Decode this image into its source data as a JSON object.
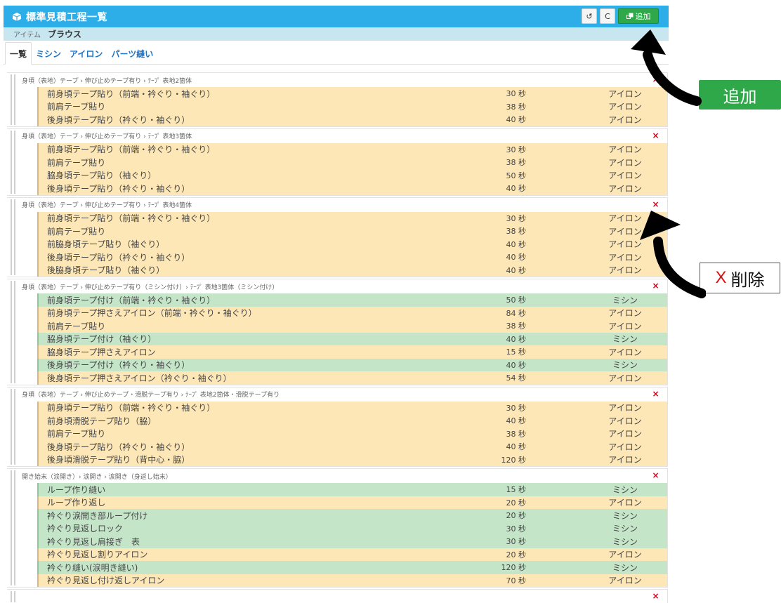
{
  "app": {
    "title": "標準見積工程一覧",
    "logo_icon": "cube-icon",
    "buttons": {
      "undo": "↺",
      "refresh": "C",
      "add": "追加"
    }
  },
  "item": {
    "label": "アイテム",
    "value": "ブラウス"
  },
  "tabs": [
    "一覧",
    "ミシン",
    "アイロン",
    "パーツ縫い"
  ],
  "groups": [
    {
      "path": "身頃（表地）テープ › 伸び止めテープ有り › ﾃｰﾌﾟ 表地2箇体",
      "rows": [
        {
          "name": "前身頃テープ貼り（前端・衿ぐり・袖ぐり）",
          "time": "30 秒",
          "proc": "アイロン",
          "type": "iron"
        },
        {
          "name": "前肩テープ貼り",
          "time": "38 秒",
          "proc": "アイロン",
          "type": "iron"
        },
        {
          "name": "後身頃テープ貼り（衿ぐり・袖ぐり）",
          "time": "40 秒",
          "proc": "アイロン",
          "type": "iron"
        }
      ]
    },
    {
      "path": "身頃（表地）テープ › 伸び止めテープ有り › ﾃｰﾌﾟ 表地3箇体",
      "rows": [
        {
          "name": "前身頃テープ貼り（前端・衿ぐり・袖ぐり）",
          "time": "30 秒",
          "proc": "アイロン",
          "type": "iron"
        },
        {
          "name": "前肩テープ貼り",
          "time": "38 秒",
          "proc": "アイロン",
          "type": "iron"
        },
        {
          "name": "脇身頃テープ貼り（袖ぐり）",
          "time": "50 秒",
          "proc": "アイロン",
          "type": "iron"
        },
        {
          "name": "後身頃テープ貼り（衿ぐり・袖ぐり）",
          "time": "40 秒",
          "proc": "アイロン",
          "type": "iron"
        }
      ]
    },
    {
      "path": "身頃（表地）テープ › 伸び止めテープ有り › ﾃｰﾌﾟ 表地4箇体",
      "rows": [
        {
          "name": "前身頃テープ貼り（前端・衿ぐり・袖ぐり）",
          "time": "30 秒",
          "proc": "アイロン",
          "type": "iron"
        },
        {
          "name": "前肩テープ貼り",
          "time": "38 秒",
          "proc": "アイロン",
          "type": "iron"
        },
        {
          "name": "前脇身頃テープ貼り（袖ぐり）",
          "time": "40 秒",
          "proc": "アイロン",
          "type": "iron"
        },
        {
          "name": "後身頃テープ貼り（衿ぐり・袖ぐり）",
          "time": "40 秒",
          "proc": "アイロン",
          "type": "iron"
        },
        {
          "name": "後脇身頃テープ貼り（袖ぐり）",
          "time": "40 秒",
          "proc": "アイロン",
          "type": "iron"
        }
      ]
    },
    {
      "path": "身頃（表地）テープ › 伸び止めテープ有り（ミシン付け）› ﾃｰﾌﾟ 表地3箇体（ミシン付け）",
      "rows": [
        {
          "name": "前身頃テープ付け（前端・衿ぐり・袖ぐり）",
          "time": "50 秒",
          "proc": "ミシン",
          "type": "mishin"
        },
        {
          "name": "前身頃テープ押さえアイロン（前端・衿ぐり・袖ぐり）",
          "time": "84 秒",
          "proc": "アイロン",
          "type": "iron"
        },
        {
          "name": "前肩テープ貼り",
          "time": "38 秒",
          "proc": "アイロン",
          "type": "iron"
        },
        {
          "name": "脇身頃テープ付け（袖ぐり）",
          "time": "40 秒",
          "proc": "ミシン",
          "type": "mishin"
        },
        {
          "name": "脇身頃テープ押さえアイロン",
          "time": "15 秒",
          "proc": "アイロン",
          "type": "iron"
        },
        {
          "name": "後身頃テープ付け（衿ぐり・袖ぐり）",
          "time": "40 秒",
          "proc": "ミシン",
          "type": "mishin"
        },
        {
          "name": "後身頃テープ押さえアイロン（衿ぐり・袖ぐり）",
          "time": "54 秒",
          "proc": "アイロン",
          "type": "iron"
        }
      ]
    },
    {
      "path": "身頃（表地）テープ › 伸び止めテープ・滑脱テープ有り › ﾃｰﾌﾟ 表地2箇体・滑脱テープ有り",
      "rows": [
        {
          "name": "前身頃テープ貼り（前端・衿ぐり・袖ぐり）",
          "time": "30 秒",
          "proc": "アイロン",
          "type": "iron"
        },
        {
          "name": "前身頃滑脱テープ貼り（脇）",
          "time": "40 秒",
          "proc": "アイロン",
          "type": "iron"
        },
        {
          "name": "前肩テープ貼り",
          "time": "38 秒",
          "proc": "アイロン",
          "type": "iron"
        },
        {
          "name": "後身頃テープ貼り（衿ぐり・袖ぐり）",
          "time": "40 秒",
          "proc": "アイロン",
          "type": "iron"
        },
        {
          "name": "後身頃滑脱テープ貼り（背中心・脇）",
          "time": "120 秒",
          "proc": "アイロン",
          "type": "iron"
        }
      ]
    },
    {
      "path": "開き始末（涙開き）› 涙開き › 涙開き（身返し始末）",
      "rows": [
        {
          "name": "ループ作り縫い",
          "time": "15 秒",
          "proc": "ミシン",
          "type": "mishin"
        },
        {
          "name": "ループ作り返し",
          "time": "20 秒",
          "proc": "アイロン",
          "type": "iron"
        },
        {
          "name": "衿ぐり涙開き部ループ付け",
          "time": "20 秒",
          "proc": "ミシン",
          "type": "mishin"
        },
        {
          "name": "衿ぐり見返しロック",
          "time": "30 秒",
          "proc": "ミシン",
          "type": "mishin"
        },
        {
          "name": "衿ぐり見返し肩接ぎ　表",
          "time": "30 秒",
          "proc": "ミシン",
          "type": "mishin"
        },
        {
          "name": "衿ぐり見返し割りアイロン",
          "time": "20 秒",
          "proc": "アイロン",
          "type": "iron"
        },
        {
          "name": "衿ぐり縫い(涙明き縫い)",
          "time": "120 秒",
          "proc": "ミシン",
          "type": "mishin"
        },
        {
          "name": "衿ぐり見返し付け返しアイロン",
          "time": "70 秒",
          "proc": "アイロン",
          "type": "iron"
        }
      ]
    },
    {
      "path": "",
      "rows": []
    }
  ],
  "delete_icon": "×",
  "callouts": {
    "add_label": "追加",
    "delete_x": "X",
    "delete_label": "削除"
  },
  "colors": {
    "title_bar": "#2eaee8",
    "item_bar": "#c8e6ef",
    "iron_row": "#fde7b7",
    "mishin_row": "#c5e5c9",
    "add_green": "#2fa84a",
    "delete_red": "#d0021b"
  }
}
